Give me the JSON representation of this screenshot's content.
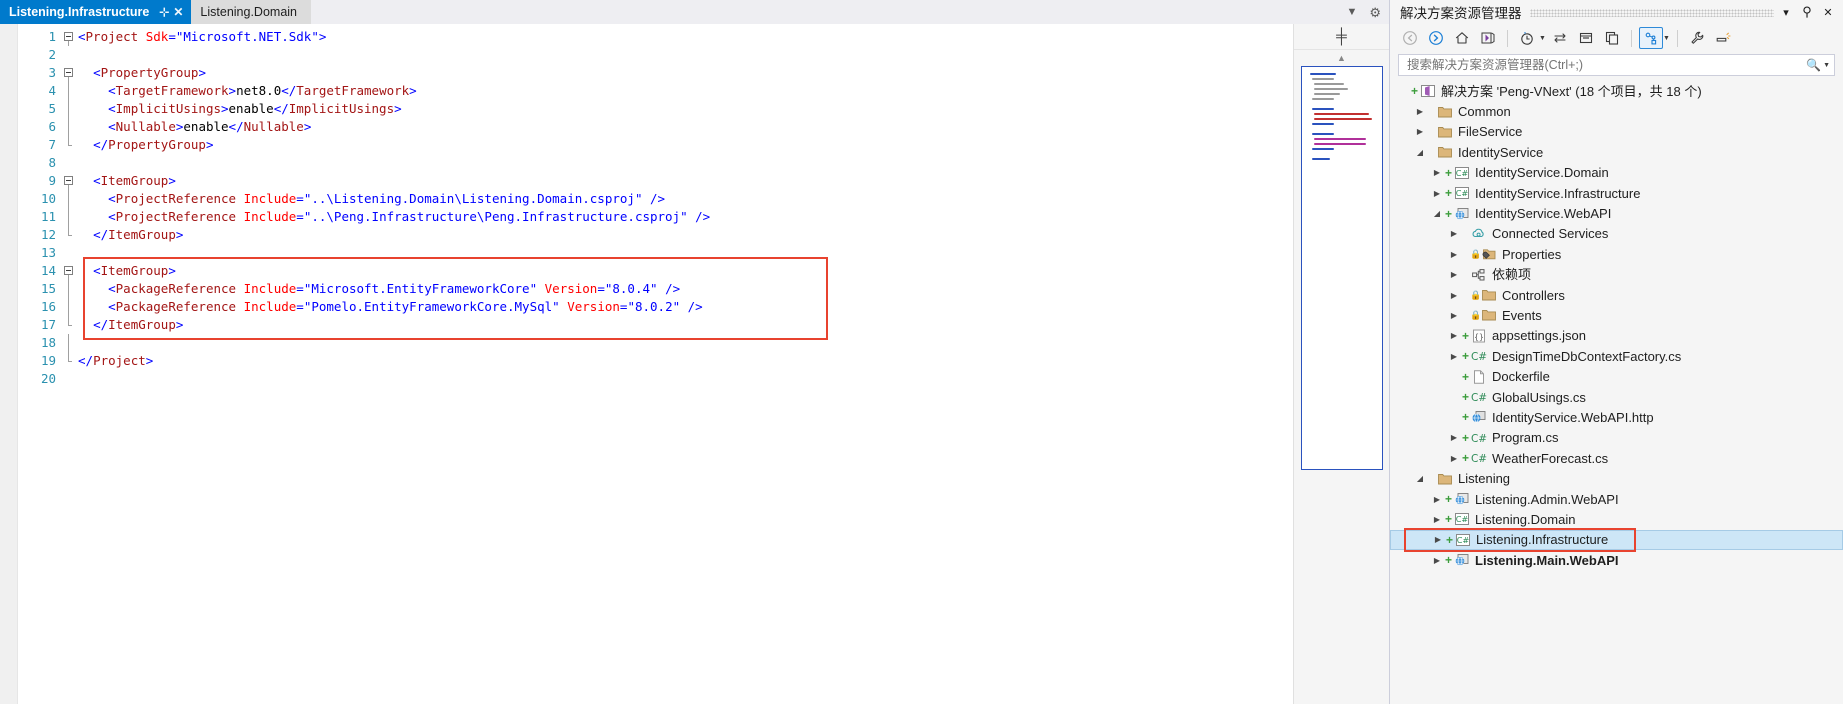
{
  "editor": {
    "tabs": [
      {
        "label": "Listening.Infrastructure",
        "active": true,
        "pin_icon": "pin-icon",
        "close_icon": "close-icon"
      },
      {
        "label": "Listening.Domain",
        "active": false
      }
    ],
    "tabstrip_right": {
      "dropdown_icon": "chevron-down-icon",
      "settings_icon": "gear-icon"
    },
    "line_numbers": [
      "1",
      "2",
      "3",
      "4",
      "5",
      "6",
      "7",
      "8",
      "9",
      "10",
      "11",
      "12",
      "13",
      "14",
      "15",
      "16",
      "17",
      "18",
      "19",
      "20"
    ],
    "code_lines": [
      {
        "n": 1,
        "tokens": [
          {
            "t": "br",
            "s": "<"
          },
          {
            "t": "tag",
            "s": "Project"
          },
          {
            "t": "txt",
            "s": " "
          },
          {
            "t": "attr",
            "s": "Sdk"
          },
          {
            "t": "br",
            "s": "="
          },
          {
            "t": "val",
            "s": "\"Microsoft.NET.Sdk\""
          },
          {
            "t": "br",
            "s": ">"
          }
        ]
      },
      {
        "n": 2,
        "tokens": []
      },
      {
        "n": 3,
        "tokens": [
          {
            "t": "txt",
            "s": "  "
          },
          {
            "t": "br",
            "s": "<"
          },
          {
            "t": "tag",
            "s": "PropertyGroup"
          },
          {
            "t": "br",
            "s": ">"
          }
        ]
      },
      {
        "n": 4,
        "tokens": [
          {
            "t": "txt",
            "s": "    "
          },
          {
            "t": "br",
            "s": "<"
          },
          {
            "t": "tag",
            "s": "TargetFramework"
          },
          {
            "t": "br",
            "s": ">"
          },
          {
            "t": "txt",
            "s": "net8.0"
          },
          {
            "t": "br",
            "s": "</"
          },
          {
            "t": "tag",
            "s": "TargetFramework"
          },
          {
            "t": "br",
            "s": ">"
          }
        ]
      },
      {
        "n": 5,
        "tokens": [
          {
            "t": "txt",
            "s": "    "
          },
          {
            "t": "br",
            "s": "<"
          },
          {
            "t": "tag",
            "s": "ImplicitUsings"
          },
          {
            "t": "br",
            "s": ">"
          },
          {
            "t": "txt",
            "s": "enable"
          },
          {
            "t": "br",
            "s": "</"
          },
          {
            "t": "tag",
            "s": "ImplicitUsings"
          },
          {
            "t": "br",
            "s": ">"
          }
        ]
      },
      {
        "n": 6,
        "tokens": [
          {
            "t": "txt",
            "s": "    "
          },
          {
            "t": "br",
            "s": "<"
          },
          {
            "t": "tag",
            "s": "Nullable"
          },
          {
            "t": "br",
            "s": ">"
          },
          {
            "t": "txt",
            "s": "enable"
          },
          {
            "t": "br",
            "s": "</"
          },
          {
            "t": "tag",
            "s": "Nullable"
          },
          {
            "t": "br",
            "s": ">"
          }
        ]
      },
      {
        "n": 7,
        "tokens": [
          {
            "t": "txt",
            "s": "  "
          },
          {
            "t": "br",
            "s": "</"
          },
          {
            "t": "tag",
            "s": "PropertyGroup"
          },
          {
            "t": "br",
            "s": ">"
          }
        ]
      },
      {
        "n": 8,
        "tokens": []
      },
      {
        "n": 9,
        "tokens": [
          {
            "t": "txt",
            "s": "  "
          },
          {
            "t": "br",
            "s": "<"
          },
          {
            "t": "tag",
            "s": "ItemGroup"
          },
          {
            "t": "br",
            "s": ">"
          }
        ]
      },
      {
        "n": 10,
        "tokens": [
          {
            "t": "txt",
            "s": "    "
          },
          {
            "t": "br",
            "s": "<"
          },
          {
            "t": "tag",
            "s": "ProjectReference"
          },
          {
            "t": "txt",
            "s": " "
          },
          {
            "t": "attr",
            "s": "Include"
          },
          {
            "t": "br",
            "s": "="
          },
          {
            "t": "val",
            "s": "\"..\\Listening.Domain\\Listening.Domain.csproj\""
          },
          {
            "t": "txt",
            "s": " "
          },
          {
            "t": "br",
            "s": "/>"
          }
        ]
      },
      {
        "n": 11,
        "tokens": [
          {
            "t": "txt",
            "s": "    "
          },
          {
            "t": "br",
            "s": "<"
          },
          {
            "t": "tag",
            "s": "ProjectReference"
          },
          {
            "t": "txt",
            "s": " "
          },
          {
            "t": "attr",
            "s": "Include"
          },
          {
            "t": "br",
            "s": "="
          },
          {
            "t": "val",
            "s": "\"..\\Peng.Infrastructure\\Peng.Infrastructure.csproj\""
          },
          {
            "t": "txt",
            "s": " "
          },
          {
            "t": "br",
            "s": "/>"
          }
        ]
      },
      {
        "n": 12,
        "tokens": [
          {
            "t": "txt",
            "s": "  "
          },
          {
            "t": "br",
            "s": "</"
          },
          {
            "t": "tag",
            "s": "ItemGroup"
          },
          {
            "t": "br",
            "s": ">"
          }
        ]
      },
      {
        "n": 13,
        "tokens": []
      },
      {
        "n": 14,
        "tokens": [
          {
            "t": "txt",
            "s": "  "
          },
          {
            "t": "br",
            "s": "<"
          },
          {
            "t": "tag",
            "s": "ItemGroup"
          },
          {
            "t": "br",
            "s": ">"
          }
        ]
      },
      {
        "n": 15,
        "tokens": [
          {
            "t": "txt",
            "s": "    "
          },
          {
            "t": "br",
            "s": "<"
          },
          {
            "t": "tag",
            "s": "PackageReference"
          },
          {
            "t": "txt",
            "s": " "
          },
          {
            "t": "attr",
            "s": "Include"
          },
          {
            "t": "br",
            "s": "="
          },
          {
            "t": "val",
            "s": "\"Microsoft.EntityFrameworkCore\""
          },
          {
            "t": "txt",
            "s": " "
          },
          {
            "t": "attr",
            "s": "Version"
          },
          {
            "t": "br",
            "s": "="
          },
          {
            "t": "val",
            "s": "\"8.0.4\""
          },
          {
            "t": "txt",
            "s": " "
          },
          {
            "t": "br",
            "s": "/>"
          }
        ]
      },
      {
        "n": 16,
        "tokens": [
          {
            "t": "txt",
            "s": "    "
          },
          {
            "t": "br",
            "s": "<"
          },
          {
            "t": "tag",
            "s": "PackageReference"
          },
          {
            "t": "txt",
            "s": " "
          },
          {
            "t": "attr",
            "s": "Include"
          },
          {
            "t": "br",
            "s": "="
          },
          {
            "t": "val",
            "s": "\"Pomelo.EntityFrameworkCore.MySql\""
          },
          {
            "t": "txt",
            "s": " "
          },
          {
            "t": "attr",
            "s": "Version"
          },
          {
            "t": "br",
            "s": "="
          },
          {
            "t": "val",
            "s": "\"8.0.2\""
          },
          {
            "t": "txt",
            "s": " "
          },
          {
            "t": "br",
            "s": "/>"
          }
        ]
      },
      {
        "n": 17,
        "tokens": [
          {
            "t": "txt",
            "s": "  "
          },
          {
            "t": "br",
            "s": "</"
          },
          {
            "t": "tag",
            "s": "ItemGroup"
          },
          {
            "t": "br",
            "s": ">"
          }
        ]
      },
      {
        "n": 18,
        "tokens": []
      },
      {
        "n": 19,
        "tokens": [
          {
            "t": "br",
            "s": "</"
          },
          {
            "t": "tag",
            "s": "Project"
          },
          {
            "t": "br",
            "s": ">"
          }
        ]
      },
      {
        "n": 20,
        "tokens": []
      }
    ],
    "highlight_color": "#e8432f",
    "overview": {
      "splitter_icon": "splitter-icon",
      "scroll_up_icon": "chevron-up-icon"
    }
  },
  "solution_explorer": {
    "title": "解决方案资源管理器",
    "header_buttons": [
      {
        "name": "window-dropdown-button",
        "glyph": "▾"
      },
      {
        "name": "pin-button",
        "glyph": "⚲"
      },
      {
        "name": "close-button",
        "glyph": "✕"
      }
    ],
    "toolbar": [
      {
        "name": "back-button",
        "icon": "back-arrow-icon"
      },
      {
        "name": "forward-button",
        "icon": "forward-arrow-icon"
      },
      {
        "name": "home-button",
        "icon": "home-icon"
      },
      {
        "name": "sync-with-document-button",
        "icon": "sync-active-document-icon"
      },
      {
        "name": "pending-changes-button",
        "icon": "clock-icon",
        "has_caret": true
      },
      {
        "name": "switch-views-button",
        "icon": "switch-views-icon"
      },
      {
        "name": "collapse-all-button",
        "icon": "collapse-all-icon"
      },
      {
        "name": "show-all-files-button",
        "icon": "show-all-files-icon"
      },
      {
        "name": "preview-selected-items-button",
        "icon": "preview-items-icon",
        "framed": true,
        "has_caret": true
      },
      {
        "name": "properties-button",
        "icon": "wrench-icon"
      },
      {
        "name": "solution-filter-button",
        "icon": "filter-icon"
      }
    ],
    "search": {
      "placeholder": "搜索解决方案资源管理器(Ctrl+;)",
      "value": "",
      "icon": "search-icon",
      "caret_icon": "chevron-down-icon"
    },
    "tree": [
      {
        "indent": 0,
        "expander": "none",
        "plus": true,
        "lock": false,
        "icon": "solution-icon",
        "label": "解决方案 'Peng-VNext' (18 个项目，共 18 个)",
        "bold": false,
        "selected": false
      },
      {
        "indent": 1,
        "expander": "collapsed",
        "plus": false,
        "lock": false,
        "icon": "folder-icon",
        "label": "Common",
        "bold": false,
        "selected": false
      },
      {
        "indent": 1,
        "expander": "collapsed",
        "plus": false,
        "lock": false,
        "icon": "folder-icon",
        "label": "FileService",
        "bold": false,
        "selected": false
      },
      {
        "indent": 1,
        "expander": "expanded",
        "plus": false,
        "lock": false,
        "icon": "folder-icon",
        "label": "IdentityService",
        "bold": false,
        "selected": false
      },
      {
        "indent": 2,
        "expander": "collapsed",
        "plus": true,
        "lock": false,
        "icon": "csharp-proj-icon",
        "label": "IdentityService.Domain",
        "bold": false,
        "selected": false
      },
      {
        "indent": 2,
        "expander": "collapsed",
        "plus": true,
        "lock": false,
        "icon": "csharp-proj-icon",
        "label": "IdentityService.Infrastructure",
        "bold": false,
        "selected": false
      },
      {
        "indent": 2,
        "expander": "expanded",
        "plus": true,
        "lock": false,
        "icon": "web-proj-icon",
        "label": "IdentityService.WebAPI",
        "bold": false,
        "selected": false
      },
      {
        "indent": 3,
        "expander": "collapsed",
        "plus": false,
        "lock": false,
        "icon": "connected-services-icon",
        "label": "Connected Services",
        "bold": false,
        "selected": false
      },
      {
        "indent": 3,
        "expander": "collapsed",
        "plus": false,
        "lock": true,
        "icon": "properties-folder-icon",
        "label": "Properties",
        "bold": false,
        "selected": false
      },
      {
        "indent": 3,
        "expander": "collapsed",
        "plus": false,
        "lock": false,
        "icon": "dependencies-icon",
        "label": "依赖项",
        "bold": false,
        "selected": false
      },
      {
        "indent": 3,
        "expander": "collapsed",
        "plus": false,
        "lock": true,
        "icon": "folder-icon",
        "label": "Controllers",
        "bold": false,
        "selected": false
      },
      {
        "indent": 3,
        "expander": "collapsed",
        "plus": false,
        "lock": true,
        "icon": "folder-icon",
        "label": "Events",
        "bold": false,
        "selected": false
      },
      {
        "indent": 3,
        "expander": "collapsed",
        "plus": true,
        "lock": false,
        "icon": "json-file-icon",
        "label": "appsettings.json",
        "bold": false,
        "selected": false
      },
      {
        "indent": 3,
        "expander": "collapsed",
        "plus": true,
        "lock": false,
        "icon": "csharp-file-icon",
        "label": "DesignTimeDbContextFactory.cs",
        "bold": false,
        "selected": false
      },
      {
        "indent": 3,
        "expander": "none",
        "plus": true,
        "lock": false,
        "icon": "blank-file-icon",
        "label": "Dockerfile",
        "bold": false,
        "selected": false
      },
      {
        "indent": 3,
        "expander": "none",
        "plus": true,
        "lock": false,
        "icon": "csharp-file-icon",
        "label": "GlobalUsings.cs",
        "bold": false,
        "selected": false
      },
      {
        "indent": 3,
        "expander": "none",
        "plus": true,
        "lock": false,
        "icon": "http-file-icon",
        "label": "IdentityService.WebAPI.http",
        "bold": false,
        "selected": false
      },
      {
        "indent": 3,
        "expander": "collapsed",
        "plus": true,
        "lock": false,
        "icon": "csharp-file-icon",
        "label": "Program.cs",
        "bold": false,
        "selected": false
      },
      {
        "indent": 3,
        "expander": "collapsed",
        "plus": true,
        "lock": false,
        "icon": "csharp-file-icon",
        "label": "WeatherForecast.cs",
        "bold": false,
        "selected": false
      },
      {
        "indent": 1,
        "expander": "expanded",
        "plus": false,
        "lock": false,
        "icon": "folder-icon",
        "label": "Listening",
        "bold": false,
        "selected": false
      },
      {
        "indent": 2,
        "expander": "collapsed",
        "plus": true,
        "lock": false,
        "icon": "web-proj-icon",
        "label": "Listening.Admin.WebAPI",
        "bold": false,
        "selected": false
      },
      {
        "indent": 2,
        "expander": "collapsed",
        "plus": true,
        "lock": false,
        "icon": "csharp-proj-icon",
        "label": "Listening.Domain",
        "bold": false,
        "selected": false
      },
      {
        "indent": 2,
        "expander": "collapsed",
        "plus": true,
        "lock": false,
        "icon": "csharp-proj-icon",
        "label": "Listening.Infrastructure",
        "bold": false,
        "selected": true
      },
      {
        "indent": 2,
        "expander": "collapsed",
        "plus": true,
        "lock": false,
        "icon": "web-proj-icon",
        "label": "Listening.Main.WebAPI",
        "bold": true,
        "selected": false
      }
    ],
    "highlight_color": "#e8432f",
    "colors": {
      "selection_bg": "#cde6f7",
      "accent": "#007acc",
      "folder": "#dcb67a"
    }
  }
}
